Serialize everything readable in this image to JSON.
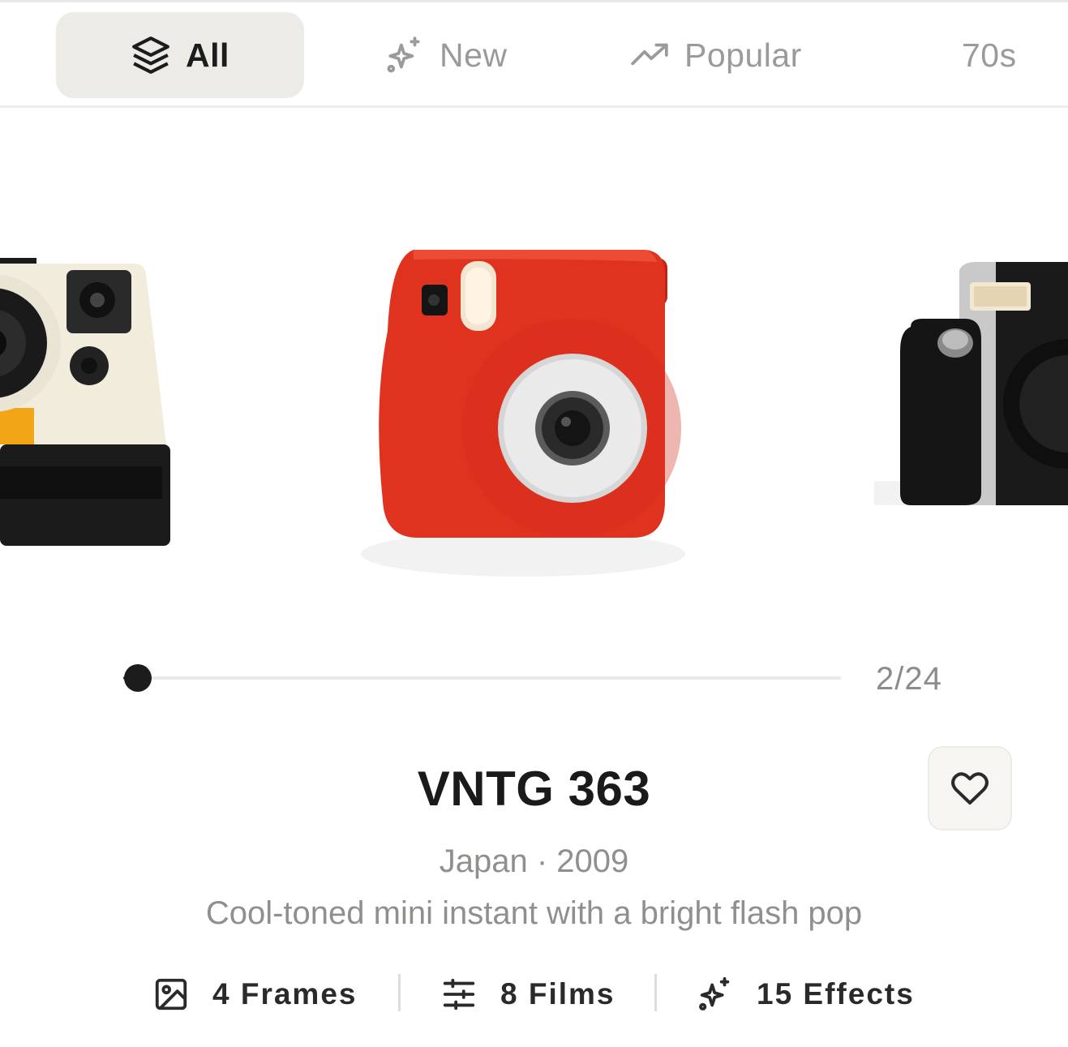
{
  "tabs": [
    {
      "label": "All",
      "icon": "layers-icon",
      "active": true
    },
    {
      "label": "New",
      "icon": "sparkles-icon",
      "active": false
    },
    {
      "label": "Popular",
      "icon": "trending-up-icon",
      "active": false
    },
    {
      "label": "70s",
      "icon": "",
      "active": false
    }
  ],
  "carousel": {
    "current": 2,
    "total": 24,
    "counter_text": "2/24",
    "progress_fraction": 0.02
  },
  "camera": {
    "name": "VNTG 363",
    "meta": "Japan · 2009",
    "description": "Cool-toned mini instant with a bright flash pop"
  },
  "stats": [
    {
      "label": "4 Frames",
      "icon": "image-icon"
    },
    {
      "label": "8 Films",
      "icon": "sliders-icon"
    },
    {
      "label": "15 Effects",
      "icon": "sparkles-icon"
    }
  ],
  "colors": {
    "accent": "#1c1c1c",
    "active_tab_bg": "#ecebe6",
    "muted_text": "#8f8f8d",
    "camera_red": "#e0331f"
  }
}
